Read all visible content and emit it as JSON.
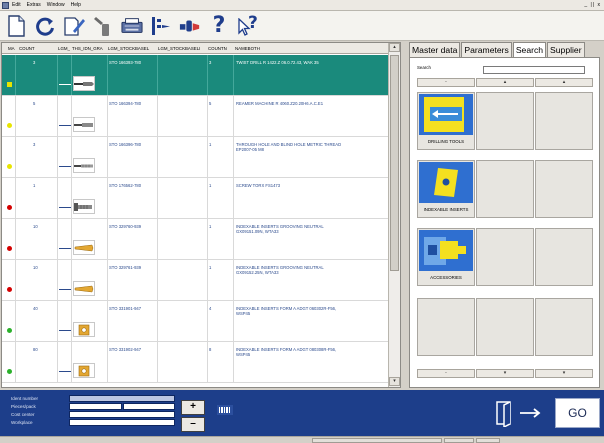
{
  "menubar": {
    "items": [
      "Edit",
      "Extras",
      "Window",
      "Help"
    ],
    "window_controls": "_ || x"
  },
  "toolbar": {
    "icons": [
      "new-document-icon",
      "refresh-icon",
      "edit-document-icon",
      "bottle-icon",
      "printer-icon",
      "tool-assembly-icon",
      "cutting-tool-icon",
      "help-question-icon",
      "help-pointer-icon"
    ],
    "help_glyph": "?",
    "help_pointer_glyph": "?"
  },
  "grid": {
    "columns": [
      "MA",
      "COUNT",
      "LGM_",
      "THS_IDN_GRA",
      "LGM_STOCKBASEL",
      "LGM_STOCKBASELI",
      "COUNTN",
      "NAMEBOTH"
    ],
    "rows": [
      {
        "count": "3",
        "stock": "STO 166393-780",
        "count_n": "3",
        "name": "TWIST DRILL R 1422.Z 06.0.72.43, WAK 35",
        "status_color": "#e8e400",
        "selected": true
      },
      {
        "count": "5",
        "stock": "STO 166394-780",
        "count_n": "5",
        "name": "REAMER MACHINE R 4060.Z20.20H6.A.C.E1",
        "status_color": "#e8e400",
        "selected": false
      },
      {
        "count": "3",
        "stock": "STO 166396-780",
        "count_n": "1",
        "name": "THROUGH HOLE AND BLIND HOLE METRIC THREAD EP2007-05 M8",
        "status_color": "#e8e400",
        "selected": false
      },
      {
        "count": "1",
        "stock": "STO 176562-780",
        "count_n": "1",
        "name": "SCREW TORX FS1473",
        "status_color": "#d40000",
        "selected": false
      },
      {
        "count": "10",
        "stock": "STO 329760-939",
        "count_n": "1",
        "name": "INDEXABLE INSERTS GROOVING NEUTRAL GX09151.09N, WTA33",
        "status_color": "#d40000",
        "selected": false
      },
      {
        "count": "10",
        "stock": "STO 329761-939",
        "count_n": "1",
        "name": "INDEXABLE INSERTS GROOVING NEUTRAL GX09152.25N, WTA33",
        "status_color": "#d40000",
        "selected": false
      },
      {
        "count": "40",
        "stock": "STO 331901-947",
        "count_n": "4",
        "name": "INDEXABLE INSERTS FORM A ADGT 060302R-F56, WSP45",
        "status_color": "#2bb02b",
        "selected": false
      },
      {
        "count": "80",
        "stock": "STO 331902-947",
        "count_n": "8",
        "name": "INDEXABLE INSERTS FORM A ADGT 080308R-F56, WSP45",
        "status_color": "#2bb02b",
        "selected": false
      }
    ]
  },
  "right_panel": {
    "tabs": [
      "Master data",
      "Parameters",
      "Search",
      "Supplier"
    ],
    "search_label": "Search",
    "categories": [
      {
        "label": "DRILLING TOOLS",
        "icon": "drilling-tools-icon"
      },
      {
        "label": "INDEXABLE INSERTS",
        "icon": "indexable-inserts-icon"
      },
      {
        "label": "ACCESSORIES",
        "icon": "accessories-icon"
      }
    ],
    "nav_arrows": [
      "-",
      "▴",
      "▴",
      "-",
      "▾",
      "▾"
    ]
  },
  "bottom": {
    "labels": [
      "Ident number",
      "Pieces/pack",
      "Cost center",
      "Workplace"
    ],
    "plus_label": "+",
    "minus_label": "–",
    "go_label": "GO"
  }
}
